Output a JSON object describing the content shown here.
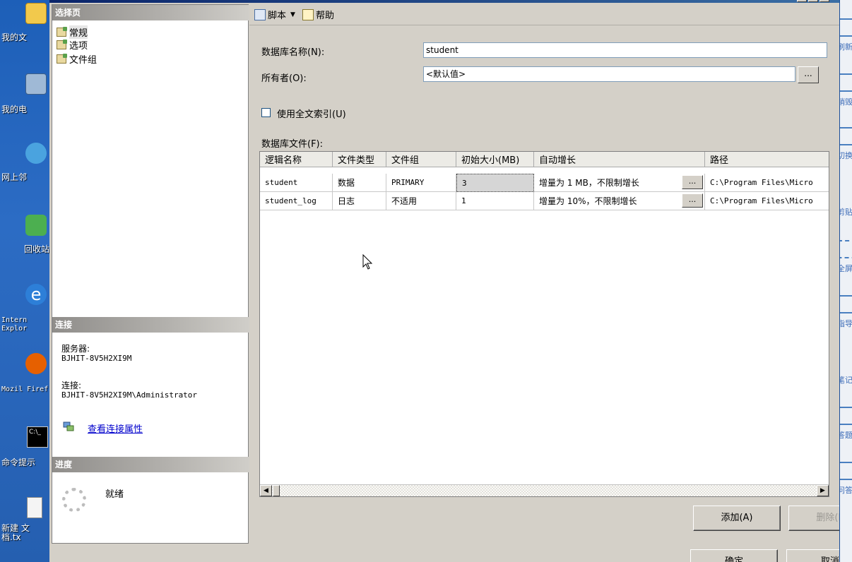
{
  "desktop": {
    "icons": [
      {
        "label": "我的文",
        "icon": "my-documents-icon"
      },
      {
        "label": "我的电",
        "icon": "my-computer-icon"
      },
      {
        "label": "网上邻",
        "icon": "network-icon"
      },
      {
        "label": "回收站",
        "icon": "recycle-bin-icon"
      },
      {
        "label": "Intern Explor",
        "icon": "ie-icon"
      },
      {
        "label": "Mozil Firef",
        "icon": "firefox-icon"
      },
      {
        "label": "命令提示",
        "icon": "cmd-icon"
      },
      {
        "label": "新建 文 档.tx",
        "icon": "text-file-icon"
      }
    ]
  },
  "left_pane": {
    "select_page_header": "选择页",
    "pages": [
      {
        "label": "常规",
        "selected": true
      },
      {
        "label": "选项",
        "selected": false
      },
      {
        "label": "文件组",
        "selected": false
      }
    ],
    "connection_header": "连接",
    "server_label": "服务器:",
    "server_value": "BJHIT-8V5H2XI9M",
    "connection_label": "连接:",
    "connection_value": "BJHIT-8V5H2XI9M\\Administrator",
    "view_props_link": "查看连接属性",
    "progress_header": "进度",
    "progress_status": "就绪"
  },
  "toolbar": {
    "script_label": "脚本",
    "help_label": "帮助"
  },
  "form": {
    "db_name_label": "数据库名称(N):",
    "db_name_value": "student",
    "owner_label": "所有者(O):",
    "owner_value": "<默认值>",
    "owner_browse": "...",
    "fulltext_label": "使用全文索引(U)",
    "fulltext_checked": false,
    "db_files_label": "数据库文件(F):"
  },
  "files_table": {
    "columns": [
      "逻辑名称",
      "文件类型",
      "文件组",
      "初始大小(MB)",
      "自动增长",
      "路径"
    ],
    "rows": [
      {
        "name": "student",
        "type": "数据",
        "filegroup": "PRIMARY",
        "size": "3",
        "growth": "增量为 1 MB，不限制增长",
        "path": "C:\\Program Files\\Micro"
      },
      {
        "name": "student_log",
        "type": "日志",
        "filegroup": "不适用",
        "size": "1",
        "growth": "增量为 10%，不限制增长",
        "path": "C:\\Program Files\\Micro"
      }
    ],
    "browse_label": "..."
  },
  "buttons": {
    "add": "添加(A)",
    "remove": "删除(R)",
    "ok": "确定",
    "cancel": "取消"
  },
  "right_bar": {
    "items": [
      {
        "label": "刷新",
        "icon": "refresh-icon"
      },
      {
        "label": "销毁",
        "icon": "trash-icon"
      },
      {
        "label": "切换",
        "icon": "switch-icon"
      },
      {
        "label": "剪贴",
        "icon": "scissors-icon"
      },
      {
        "label": "全屏",
        "icon": "fullscreen-icon"
      },
      {
        "label": "指导",
        "icon": "guide-icon"
      },
      {
        "label": "笔记",
        "icon": "pen-icon"
      },
      {
        "label": "答题",
        "icon": "answer-icon"
      },
      {
        "label": "问答",
        "icon": "qa-icon"
      }
    ]
  },
  "colors": {
    "desktop_bg": "#2a5ea8",
    "dialog_bg": "#d4d0c8",
    "section_header": "#8f8d8a",
    "link": "#0000cc"
  }
}
